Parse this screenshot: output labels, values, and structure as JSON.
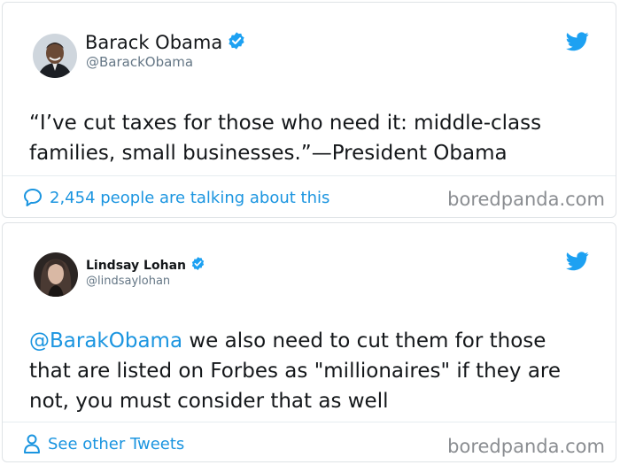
{
  "tweets": [
    {
      "author_name": "Barack Obama",
      "handle": "@BarackObama",
      "verified": true,
      "text": "“I’ve cut taxes for those who need it: middle-class families, small businesses.”—President Obama",
      "footer": "2,454 people are talking about this",
      "footer_icon": "speech-bubble-icon",
      "watermark": "boredpanda.com"
    },
    {
      "author_name": "Lindsay Lohan",
      "handle": "@lindsaylohan",
      "verified": true,
      "mention": "@BarakObama",
      "text": " we also need to cut them for those that are listed on Forbes as \"millionaires\" if they are not, you must consider that as well",
      "footer": "See other Tweets",
      "footer_icon": "person-icon",
      "watermark": "boredpanda.com"
    }
  ],
  "colors": {
    "twitter_blue": "#1da1f2",
    "link_blue": "#1b95e0",
    "handle_gray": "#657786",
    "text": "#14171a"
  }
}
